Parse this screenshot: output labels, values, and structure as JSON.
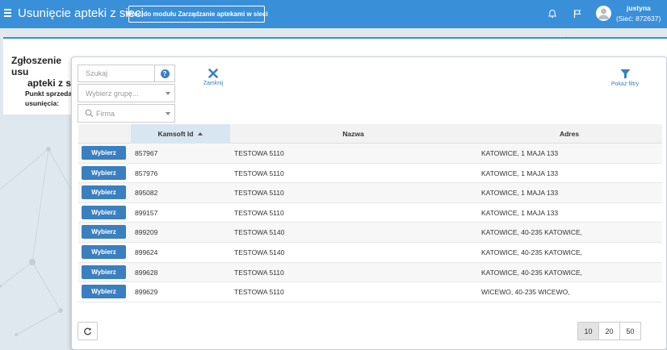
{
  "header": {
    "title": "Usunięcie apteki z sieci",
    "back_label": "Wróć do modułu Zarządzanie aptekami w sieci",
    "user_name": "justyna",
    "user_network": "(Sieć: 872637)"
  },
  "background_panel": {
    "title_line1": "Zgłoszenie usu",
    "title_line2": "apteki z si",
    "label_line1": "Punkt sprzedaż",
    "label_line2": "usunięcia:"
  },
  "modal": {
    "search_placeholder": "Szukaj",
    "group_placeholder": "Wybierz grupę...",
    "firm_placeholder": "Firma",
    "close_label": "Zamknij",
    "filters_label": "Pokaż filtry",
    "columns": [
      "Kamsoft Id",
      "Nazwa",
      "Adres"
    ],
    "select_label": "Wybierz",
    "rows": [
      {
        "id": "857967",
        "name": "TESTOWA 5110",
        "address": "KATOWICE, 1 MAJA 133"
      },
      {
        "id": "857976",
        "name": "TESTOWA 5110",
        "address": "KATOWICE, 1 MAJA 133"
      },
      {
        "id": "895082",
        "name": "TESTOWA 5110",
        "address": "KATOWICE, 1 MAJA 133"
      },
      {
        "id": "899157",
        "name": "TESTOWA 5110",
        "address": "KATOWICE, 1 MAJA 133"
      },
      {
        "id": "899209",
        "name": "TESTOWA 5140",
        "address": "KATOWICE, 40-235 KATOWICE,"
      },
      {
        "id": "899624",
        "name": "TESTOWA 5140",
        "address": "KATOWICE, 40-235 KATOWICE,"
      },
      {
        "id": "899628",
        "name": "TESTOWA 5110",
        "address": "KATOWICE, 40-235 KATOWICE,"
      },
      {
        "id": "899629",
        "name": "TESTOWA 5110",
        "address": "WICEWO, 40-235 WICEWO,"
      }
    ],
    "page_sizes": [
      "10",
      "20",
      "50"
    ],
    "active_page_size": "10"
  },
  "colors": {
    "topbar": "#3a8fd9",
    "button": "#3a7fbf",
    "sorted_header": "#d8e6f2"
  }
}
